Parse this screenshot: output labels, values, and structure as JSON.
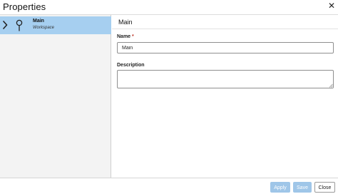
{
  "dialog": {
    "title": "Properties",
    "close_glyph": "✕"
  },
  "tree": {
    "items": [
      {
        "name": "Main",
        "subtitle": "Workspace",
        "icon": "pin-icon",
        "expand_icon": "chevron-right-icon",
        "selected": true
      }
    ],
    "selected_bg": "#a6cff0"
  },
  "details": {
    "heading": "Main",
    "name_label": "Name",
    "required_mark": "*",
    "name_value": "Main",
    "description_label": "Description",
    "description_value": ""
  },
  "footer": {
    "apply_label": "Apply",
    "save_label": "Save",
    "close_label": "Close"
  },
  "colors": {
    "accent": "#9fc6e8",
    "required": "#c0392b"
  }
}
